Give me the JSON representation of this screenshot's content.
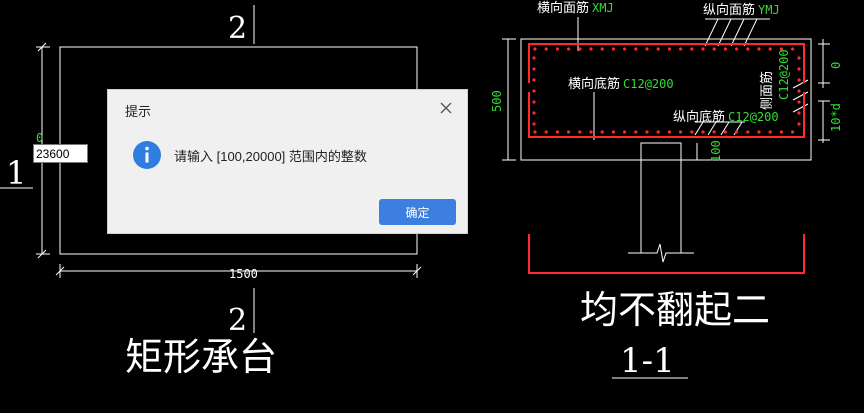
{
  "drawing": {
    "plan": {
      "section_mark_top": "2",
      "section_mark_bottom": "2",
      "side_mark": "1",
      "width_dim": "1500",
      "height_dim_fragment": "0",
      "title": "矩形承台"
    },
    "section": {
      "label_top_transverse": "横向面筋",
      "label_top_transverse_code": "XMJ",
      "label_top_longitudinal": "纵向面筋",
      "label_top_longitudinal_code": "YMJ",
      "label_bottom_transverse": "横向底筋",
      "label_bottom_transverse_code": "C12@200",
      "label_bottom_longitudinal": "纵向底筋",
      "label_bottom_longitudinal_code": "C12@200",
      "label_side": "侧面筋",
      "label_side_code": "C12@200",
      "dim_height": "500",
      "dim_top_cover": "0",
      "dim_anchor": "10*d",
      "dim_pile_embed": "100",
      "caption": "均不翻起二",
      "section_id": "1-1"
    },
    "colors": {
      "line": "#ffffff",
      "rebar": "#ff2a2a",
      "dimension_text": "#33dd33",
      "background": "#000000"
    }
  },
  "input": {
    "value": "23600"
  },
  "dialog": {
    "title": "提示",
    "message": "请输入 [100,20000] 范围内的整数",
    "ok_label": "确定",
    "icon": "info-icon",
    "accent": "#2f7de1"
  }
}
